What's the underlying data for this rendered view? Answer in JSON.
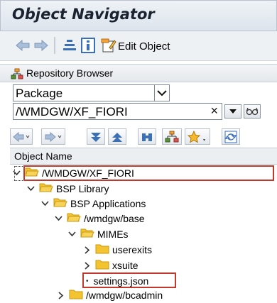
{
  "window": {
    "title": "Object Navigator"
  },
  "toolbar": {
    "edit_object_label": "Edit Object"
  },
  "repository": {
    "title": "Repository Browser",
    "object_type": "Package",
    "package_path": "/WMDGW/XF_FIORI",
    "clear_symbol": "×"
  },
  "tree": {
    "column_header": "Object Name",
    "nodes": [
      {
        "label": "/WMDGW/XF_FIORI",
        "expanded": true
      },
      {
        "label": "BSP Library",
        "expanded": true
      },
      {
        "label": "BSP Applications",
        "expanded": true
      },
      {
        "label": "/wmdgw/base",
        "expanded": true
      },
      {
        "label": "MIMEs",
        "expanded": true
      },
      {
        "label": "userexits",
        "expanded": false
      },
      {
        "label": "xsuite",
        "expanded": false
      },
      {
        "label": "settings.json",
        "bullet": "•"
      },
      {
        "label": "/wmdgw/bcadmin",
        "expanded": false
      }
    ]
  },
  "colors": {
    "highlight_box": "#c0392b",
    "folder_yellow": "#f4c430",
    "toolbar_blue": "#3b6fb6"
  }
}
